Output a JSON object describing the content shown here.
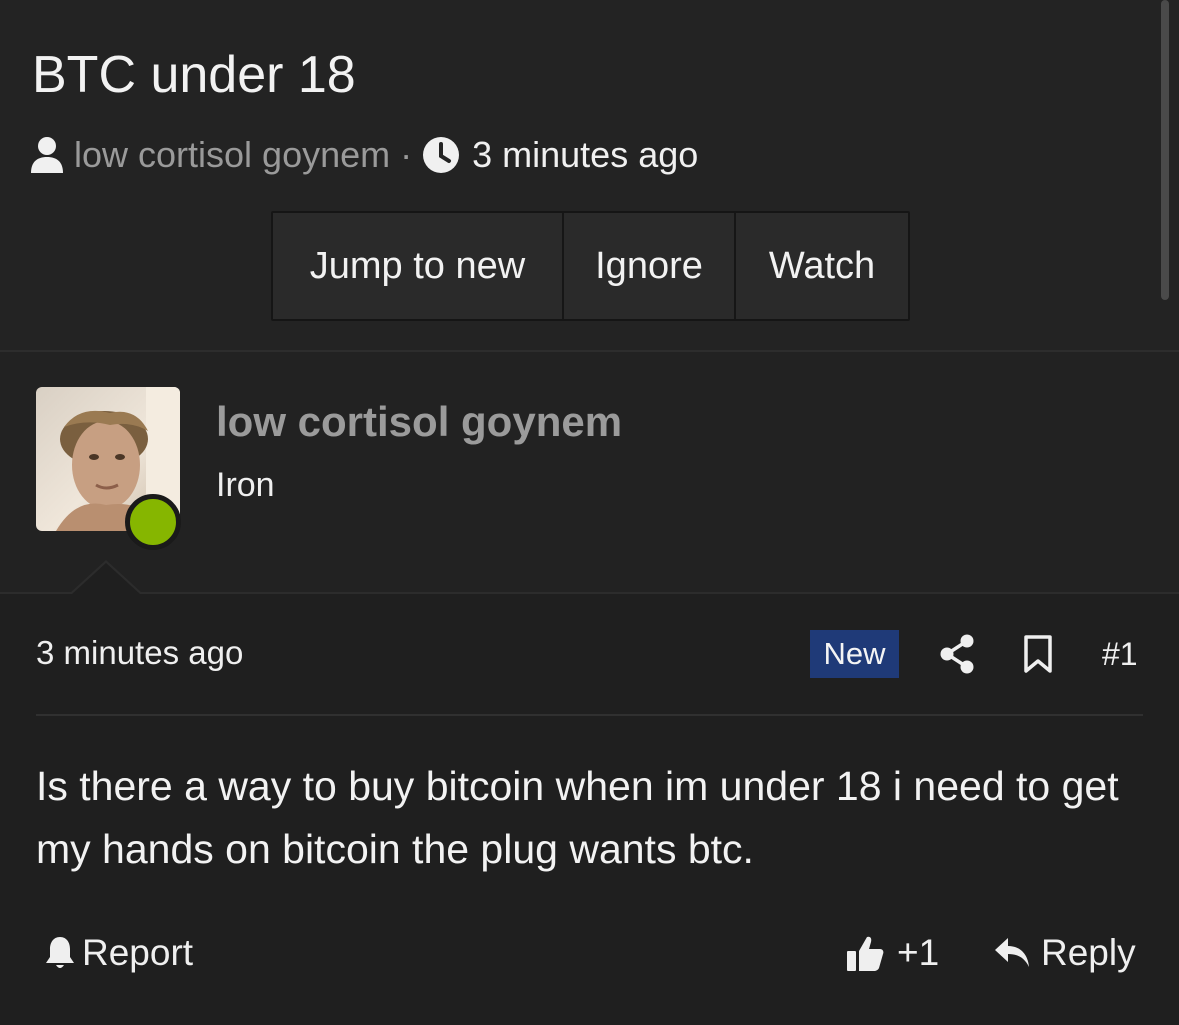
{
  "thread": {
    "title": "BTC under 18",
    "author": "low cortisol goynem",
    "separator": "·",
    "time": "3 minutes ago"
  },
  "actions": {
    "jump_to_new": "Jump to new",
    "ignore": "Ignore",
    "watch": "Watch"
  },
  "user": {
    "name": "low cortisol goynem",
    "title": "Iron",
    "status": "online",
    "status_color": "#86b600"
  },
  "post": {
    "time": "3 minutes ago",
    "badge": "New",
    "badge_color": "#1f3a78",
    "number": "#1",
    "body": "Is there a way to buy bitcoin when im under 18 i need to get my hands on bitcoin the plug wants btc."
  },
  "footer": {
    "report": "Report",
    "like_count": "+1",
    "reply": "Reply"
  },
  "icons": [
    "user-icon",
    "clock-icon",
    "share-icon",
    "bookmark-icon",
    "bell-icon",
    "thumbs-up-icon",
    "reply-arrow-icon"
  ]
}
